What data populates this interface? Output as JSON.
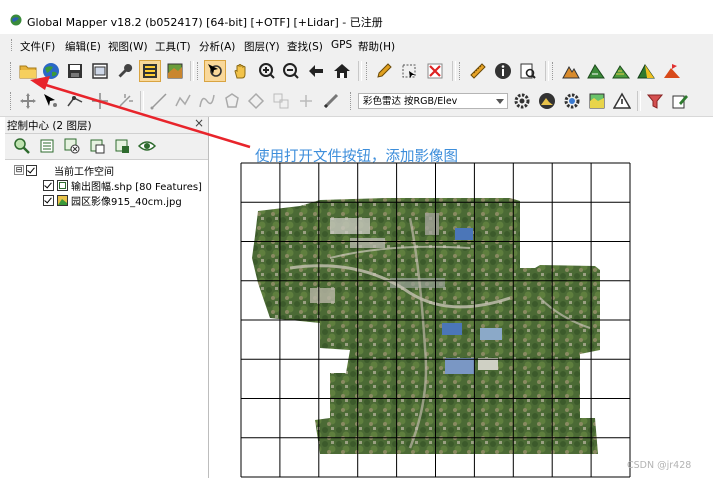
{
  "window": {
    "title": "Global Mapper v18.2 (b052417) [64-bit] [+OTF] [+Lidar] - 已注册"
  },
  "menubar": {
    "items": [
      {
        "label": "文件(F)"
      },
      {
        "label": "编辑(E)"
      },
      {
        "label": "视图(W)"
      },
      {
        "label": "工具(T)"
      },
      {
        "label": "分析(A)"
      },
      {
        "label": "图层(Y)"
      },
      {
        "label": "查找(S)"
      },
      {
        "label": "GPS"
      },
      {
        "label": "帮助(H)"
      }
    ]
  },
  "toolbar2": {
    "shader_select": "彩色雷达 按RGB/Elev"
  },
  "control_center": {
    "title": "控制中心 (2 图层)",
    "close": "×",
    "tree": {
      "root_label": "当前工作空间",
      "expander": "⊟",
      "layers": [
        {
          "label": "输出图幅.shp [80 Features]",
          "checked": true
        },
        {
          "label": "园区影像915_40cm.jpg",
          "checked": true
        }
      ]
    }
  },
  "annotation": {
    "text": "使用打开文件按钮，添加影像图",
    "color": "#3d8edb",
    "arrow_color": "#e8242b"
  },
  "watermark": "CSDN @jr428",
  "map": {
    "grid_cols": 10,
    "grid_rows": 8
  }
}
